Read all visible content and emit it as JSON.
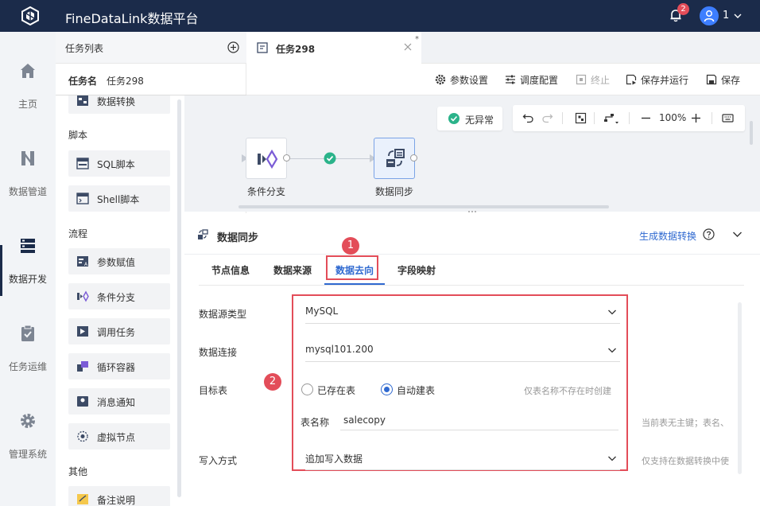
{
  "app": {
    "title": "FineDataLink数据平台",
    "notification_count": "2",
    "user_label": "1"
  },
  "nav": {
    "items": [
      {
        "label": "主页",
        "icon": "home-icon"
      },
      {
        "label": "数据管道",
        "icon": "pipeline-icon"
      },
      {
        "label": "数据开发",
        "icon": "dev-icon",
        "active": true
      },
      {
        "label": "任务运维",
        "icon": "ops-icon"
      },
      {
        "label": "管理系统",
        "icon": "gear-icon"
      }
    ]
  },
  "task_panel": {
    "header": "任务列表",
    "task_name_label": "任务名",
    "task_name_value": "任务298",
    "groups": {
      "script": "脚本",
      "flow": "流程",
      "other": "其他"
    },
    "components": {
      "data_transform": "数据转换",
      "sql": "SQL脚本",
      "shell": "Shell脚本",
      "param": "参数赋值",
      "condition": "条件分支",
      "call_task": "调用任务",
      "loop": "循环容器",
      "message": "消息通知",
      "virtual": "虚拟节点",
      "note": "备注说明"
    }
  },
  "tab": {
    "label": "任务298",
    "modified": "*"
  },
  "toolbar": {
    "params": "参数设置",
    "schedule": "调度配置",
    "stop": "终止",
    "save_run": "保存并运行",
    "save": "保存"
  },
  "canvas": {
    "status": "无异常",
    "zoom": "100%",
    "nodes": {
      "condition": "条件分支",
      "sync": "数据同步"
    }
  },
  "props": {
    "title": "数据同步",
    "generate_link": "生成数据转换",
    "tabs": [
      "节点信息",
      "数据来源",
      "数据去向",
      "字段映射"
    ],
    "active_tab": "数据去向",
    "markers": [
      "1",
      "2"
    ],
    "fields": {
      "source_type_label": "数据源类型",
      "source_type_value": "MySQL",
      "connection_label": "数据连接",
      "connection_value": "mysql101.200",
      "target_label": "目标表",
      "existing_table": "已存在表",
      "auto_create": "自动建表",
      "auto_create_hint": "仅表名称不存在时创建",
      "table_name_label": "表名称",
      "table_name_value": "salecopy",
      "table_name_hint": "当前表无主键；表名、",
      "write_mode_label": "写入方式",
      "write_mode_value": "追加写入数据",
      "write_mode_hint": "仅支持在数据转换中使"
    }
  },
  "colors": {
    "topbar": "#1b2b4a",
    "accent": "#2f69d0",
    "highlight": "#e34d59",
    "success": "#2bb38a"
  }
}
